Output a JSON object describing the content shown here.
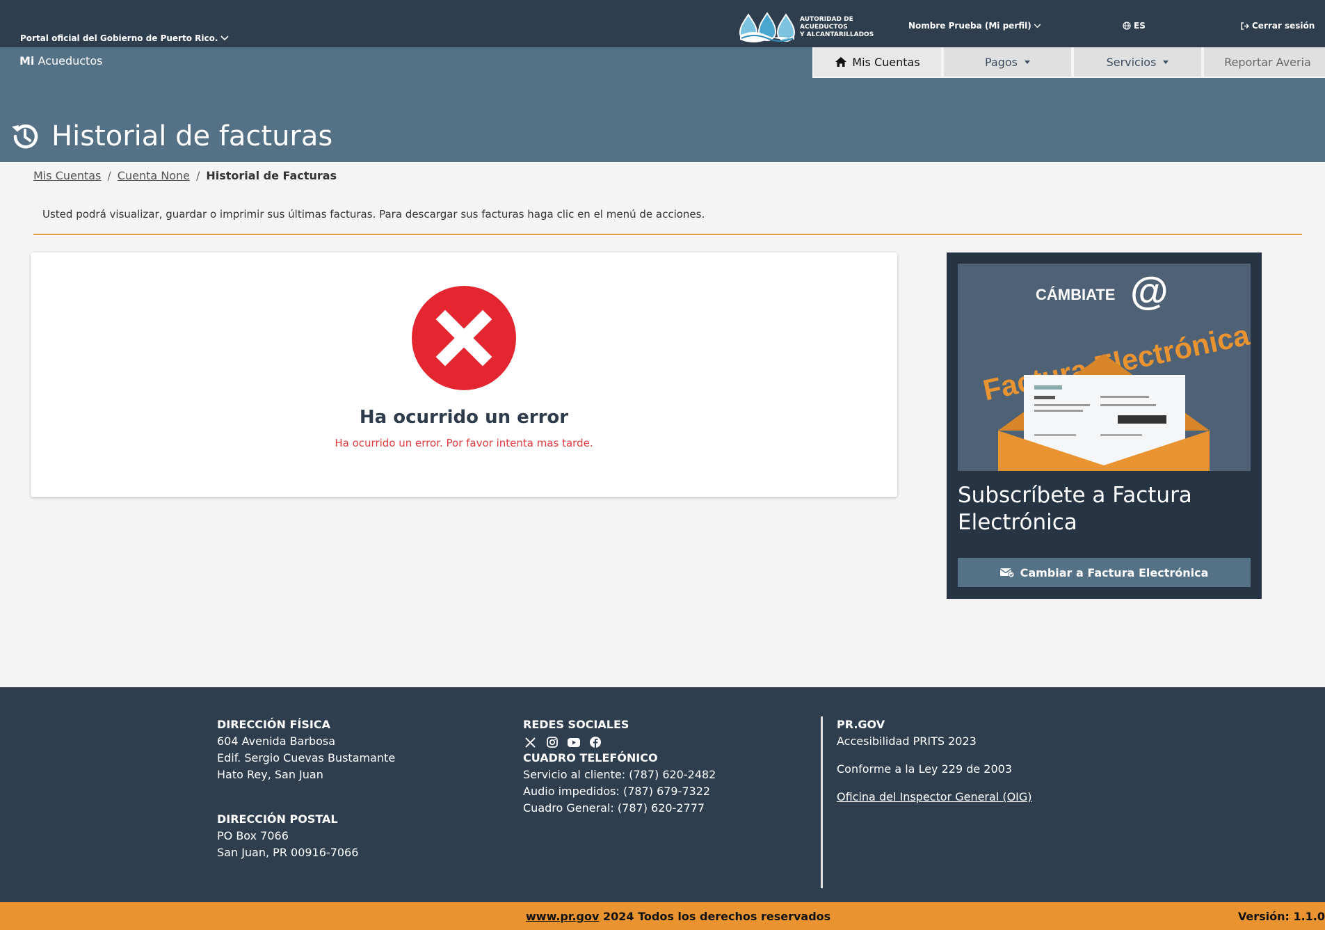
{
  "topbar": {
    "gov_link": "Portal oficial del Gobierno de Puerto Rico.",
    "brand_line1": "AUTORIDAD DE ACUEDUCTOS",
    "brand_line2": "Y ALCANTARILLADOS",
    "profile": "Nombre Prueba (Mi perfil)",
    "language": "ES",
    "logout": "Cerrar sesión"
  },
  "app": {
    "name_bold": "Mi",
    "name_rest": "Acueductos"
  },
  "nav": {
    "items": [
      {
        "label": "Mis Cuentas",
        "icon": "home-icon"
      },
      {
        "label": "Pagos"
      },
      {
        "label": "Servicios"
      },
      {
        "label": "Reportar Averia"
      }
    ]
  },
  "page": {
    "title": "Historial de facturas"
  },
  "breadcrumb": {
    "items": [
      "Mis Cuentas",
      "Cuenta None"
    ],
    "current": "Historial de Facturas",
    "separator": "/"
  },
  "info": "Usted podrá visualizar, guardar o imprimir sus últimas facturas. Para descargar sus facturas haga clic en el menú de acciones.",
  "error": {
    "title": "Ha ocurrido un error",
    "message": "Ha ocurrido un error. Por favor intenta mas tarde."
  },
  "promo": {
    "image_text_1": "CÁMBIATE",
    "image_text_2": "Factura Electrónica",
    "title": "Subscríbete a Factura Electrónica",
    "button": "Cambiar a Factura Electrónica"
  },
  "footer": {
    "physical_heading": "DIRECCIÓN FÍSICA",
    "physical_lines": [
      "604 Avenida Barbosa",
      "Edif. Sergio Cuevas Bustamante",
      "Hato Rey, San Juan"
    ],
    "postal_heading": "DIRECCIÓN POSTAL",
    "postal_lines": [
      "PO Box 7066",
      "San Juan, PR 00916-7066"
    ],
    "social_heading": "REDES SOCIALES",
    "phone_heading": "CUADRO TELEFÓNICO",
    "phone_lines": [
      "Servicio al cliente: (787) 620-2482",
      "Audio impedidos: (787) 679-7322",
      "Cuadro General: (787) 620-2777"
    ],
    "prgov_heading": "PR.GOV",
    "prgov_lines": [
      "Accesibilidad PRITS 2023",
      "Conforme a la Ley 229 de 2003"
    ],
    "oig_link": "Oficina del Inspector General (OIG)"
  },
  "bottom": {
    "link": "www.pr.gov",
    "rest": " 2024 Todos los derechos reservados",
    "version": "Versión: 1.1.0"
  },
  "colors": {
    "header": "#2f3e4e",
    "hero": "#557185",
    "accent": "#e99430",
    "error": "#e3262f"
  }
}
